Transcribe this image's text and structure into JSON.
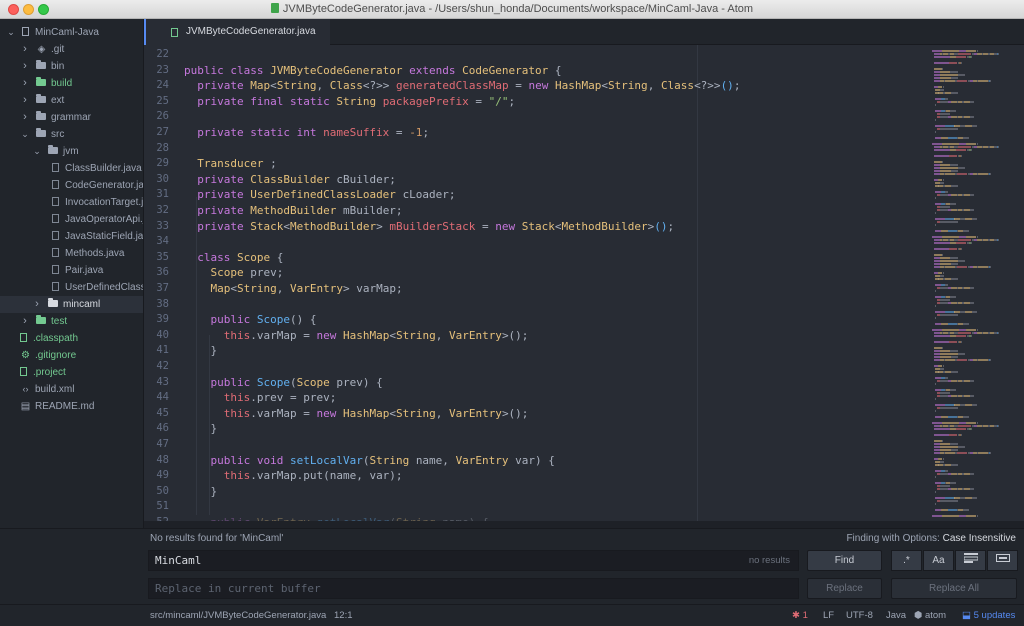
{
  "window": {
    "title": "JVMByteCodeGenerator.java - /Users/shun_honda/Documents/workspace/MinCaml-Java - Atom"
  },
  "tree": {
    "items": [
      {
        "label": "MinCaml-Java",
        "depth": 0,
        "type": "project",
        "expanded": true,
        "color": "normal"
      },
      {
        "label": ".git",
        "depth": 1,
        "type": "folder",
        "expanded": false,
        "color": "normal",
        "icon": "git-icon"
      },
      {
        "label": "bin",
        "depth": 1,
        "type": "folder",
        "expanded": false,
        "color": "normal"
      },
      {
        "label": "build",
        "depth": 1,
        "type": "folder",
        "expanded": false,
        "color": "green"
      },
      {
        "label": "ext",
        "depth": 1,
        "type": "folder",
        "expanded": false,
        "color": "normal"
      },
      {
        "label": "grammar",
        "depth": 1,
        "type": "folder",
        "expanded": false,
        "color": "normal"
      },
      {
        "label": "src",
        "depth": 1,
        "type": "folder",
        "expanded": true,
        "color": "normal"
      },
      {
        "label": "jvm",
        "depth": 2,
        "type": "folder",
        "expanded": true,
        "color": "normal"
      },
      {
        "label": "ClassBuilder.java",
        "depth": 3,
        "type": "file",
        "color": "normal"
      },
      {
        "label": "CodeGenerator.java",
        "depth": 3,
        "type": "file",
        "color": "normal"
      },
      {
        "label": "InvocationTarget.java",
        "depth": 3,
        "type": "file",
        "color": "normal"
      },
      {
        "label": "JavaOperatorApi.java",
        "depth": 3,
        "type": "file",
        "color": "normal"
      },
      {
        "label": "JavaStaticField.java",
        "depth": 3,
        "type": "file",
        "color": "normal"
      },
      {
        "label": "Methods.java",
        "depth": 3,
        "type": "file",
        "color": "normal"
      },
      {
        "label": "Pair.java",
        "depth": 3,
        "type": "file",
        "color": "normal"
      },
      {
        "label": "UserDefinedClassLoader.java",
        "depth": 3,
        "type": "file",
        "color": "normal"
      },
      {
        "label": "mincaml",
        "depth": 2,
        "type": "folder",
        "expanded": false,
        "color": "bright",
        "selected": true
      },
      {
        "label": "test",
        "depth": 1,
        "type": "folder",
        "expanded": false,
        "color": "green"
      },
      {
        "label": ".classpath",
        "depth": 1,
        "type": "file",
        "color": "green"
      },
      {
        "label": ".gitignore",
        "depth": 1,
        "type": "file",
        "color": "green",
        "icon": "gear-icon"
      },
      {
        "label": ".project",
        "depth": 1,
        "type": "file",
        "color": "green"
      },
      {
        "label": "build.xml",
        "depth": 1,
        "type": "file",
        "color": "normal",
        "icon": "code-icon"
      },
      {
        "label": "README.md",
        "depth": 1,
        "type": "file",
        "color": "normal",
        "icon": "markdown-icon"
      }
    ]
  },
  "tabs": [
    {
      "label": "JVMByteCodeGenerator.java",
      "active": true
    }
  ],
  "editor": {
    "lines": [
      {
        "num": "22",
        "tokens": []
      },
      {
        "num": "23",
        "tokens": [
          [
            "k",
            "public class "
          ],
          [
            "t",
            "JVMByteCodeGenerator "
          ],
          [
            "k",
            "extends "
          ],
          [
            "t",
            "CodeGenerator"
          ],
          [
            "p",
            " {"
          ]
        ]
      },
      {
        "num": "24",
        "tokens": [
          [
            "k",
            "  private "
          ],
          [
            "t",
            "Map"
          ],
          [
            "p",
            "<"
          ],
          [
            "t",
            "String"
          ],
          [
            "p",
            ", "
          ],
          [
            "t",
            "Class"
          ],
          [
            "p",
            "<?>> "
          ],
          [
            "v",
            "generatedClassMap"
          ],
          [
            "p",
            " = "
          ],
          [
            "k",
            "new "
          ],
          [
            "t",
            "HashMap"
          ],
          [
            "p",
            "<"
          ],
          [
            "t",
            "String"
          ],
          [
            "p",
            ", "
          ],
          [
            "t",
            "Class"
          ],
          [
            "p",
            "<?>>"
          ],
          [
            "f",
            "()"
          ],
          [
            "p",
            ";"
          ]
        ]
      },
      {
        "num": "25",
        "tokens": [
          [
            "k",
            "  private final static "
          ],
          [
            "t",
            "String "
          ],
          [
            "v",
            "packagePrefix"
          ],
          [
            "p",
            " = "
          ],
          [
            "s",
            "\"/\""
          ],
          [
            "p",
            ";"
          ]
        ]
      },
      {
        "num": "26",
        "tokens": []
      },
      {
        "num": "27",
        "tokens": [
          [
            "k",
            "  private static int "
          ],
          [
            "v",
            "nameSuffix"
          ],
          [
            "p",
            " = "
          ],
          [
            "n",
            "-1"
          ],
          [
            "p",
            ";"
          ]
        ]
      },
      {
        "num": "28",
        "tokens": []
      },
      {
        "num": "29",
        "tokens": [
          [
            "t",
            "  Transducer "
          ],
          [
            "p",
            ";"
          ]
        ]
      },
      {
        "num": "30",
        "tokens": [
          [
            "k",
            "  private "
          ],
          [
            "t",
            "ClassBuilder "
          ],
          [
            "p",
            "cBuilder;"
          ]
        ]
      },
      {
        "num": "31",
        "tokens": [
          [
            "k",
            "  private "
          ],
          [
            "t",
            "UserDefinedClassLoader "
          ],
          [
            "p",
            "cLoader;"
          ]
        ]
      },
      {
        "num": "32",
        "tokens": [
          [
            "k",
            "  private "
          ],
          [
            "t",
            "MethodBuilder "
          ],
          [
            "p",
            "mBuilder;"
          ]
        ]
      },
      {
        "num": "33",
        "tokens": [
          [
            "k",
            "  private "
          ],
          [
            "t",
            "Stack"
          ],
          [
            "p",
            "<"
          ],
          [
            "t",
            "MethodBuilder"
          ],
          [
            "p",
            "> "
          ],
          [
            "v",
            "mBuilderStack"
          ],
          [
            "p",
            " = "
          ],
          [
            "k",
            "new "
          ],
          [
            "t",
            "Stack"
          ],
          [
            "p",
            "<"
          ],
          [
            "t",
            "MethodBuilder"
          ],
          [
            "p",
            ">"
          ],
          [
            "f",
            "()"
          ],
          [
            "p",
            ";"
          ]
        ]
      },
      {
        "num": "34",
        "tokens": []
      },
      {
        "num": "35",
        "tokens": [
          [
            "k",
            "  class "
          ],
          [
            "t",
            "Scope"
          ],
          [
            "p",
            " {"
          ]
        ]
      },
      {
        "num": "36",
        "tokens": [
          [
            "t",
            "    Scope "
          ],
          [
            "p",
            "prev;"
          ]
        ]
      },
      {
        "num": "37",
        "tokens": [
          [
            "t",
            "    Map"
          ],
          [
            "p",
            "<"
          ],
          [
            "t",
            "String"
          ],
          [
            "p",
            ", "
          ],
          [
            "t",
            "VarEntry"
          ],
          [
            "p",
            "> varMap;"
          ]
        ]
      },
      {
        "num": "38",
        "tokens": []
      },
      {
        "num": "39",
        "tokens": [
          [
            "k",
            "    public "
          ],
          [
            "f",
            "Scope"
          ],
          [
            "p",
            "() {"
          ]
        ]
      },
      {
        "num": "40",
        "tokens": [
          [
            "v",
            "      this"
          ],
          [
            "p",
            ".varMap = "
          ],
          [
            "k",
            "new "
          ],
          [
            "t",
            "HashMap"
          ],
          [
            "p",
            "<"
          ],
          [
            "t",
            "String"
          ],
          [
            "p",
            ", "
          ],
          [
            "t",
            "VarEntry"
          ],
          [
            "p",
            ">();"
          ]
        ]
      },
      {
        "num": "41",
        "tokens": [
          [
            "p",
            "    }"
          ]
        ]
      },
      {
        "num": "42",
        "tokens": []
      },
      {
        "num": "43",
        "tokens": [
          [
            "k",
            "    public "
          ],
          [
            "f",
            "Scope"
          ],
          [
            "p",
            "("
          ],
          [
            "t",
            "Scope "
          ],
          [
            "p",
            "prev) {"
          ]
        ]
      },
      {
        "num": "44",
        "tokens": [
          [
            "v",
            "      this"
          ],
          [
            "p",
            ".prev = prev;"
          ]
        ]
      },
      {
        "num": "45",
        "tokens": [
          [
            "v",
            "      this"
          ],
          [
            "p",
            ".varMap = "
          ],
          [
            "k",
            "new "
          ],
          [
            "t",
            "HashMap"
          ],
          [
            "p",
            "<"
          ],
          [
            "t",
            "String"
          ],
          [
            "p",
            ", "
          ],
          [
            "t",
            "VarEntry"
          ],
          [
            "p",
            ">();"
          ]
        ]
      },
      {
        "num": "46",
        "tokens": [
          [
            "p",
            "    }"
          ]
        ]
      },
      {
        "num": "47",
        "tokens": []
      },
      {
        "num": "48",
        "tokens": [
          [
            "k",
            "    public void "
          ],
          [
            "f",
            "setLocalVar"
          ],
          [
            "p",
            "("
          ],
          [
            "t",
            "String "
          ],
          [
            "p",
            "name, "
          ],
          [
            "t",
            "VarEntry "
          ],
          [
            "p",
            "var) {"
          ]
        ]
      },
      {
        "num": "49",
        "tokens": [
          [
            "v",
            "      this"
          ],
          [
            "p",
            ".varMap.put(name, var);"
          ]
        ]
      },
      {
        "num": "50",
        "tokens": [
          [
            "p",
            "    }"
          ]
        ]
      },
      {
        "num": "51",
        "tokens": []
      },
      {
        "num": "52",
        "tokens": [
          [
            "k",
            "    public "
          ],
          [
            "t",
            "VarEntry "
          ],
          [
            "f",
            "getLocalVar"
          ],
          [
            "p",
            "("
          ],
          [
            "t",
            "String "
          ],
          [
            "p",
            "name) {"
          ]
        ]
      }
    ]
  },
  "find": {
    "message": "No results found for 'MinCaml'",
    "options_prefix": "Finding with Options: ",
    "options_value": "Case Insensitive",
    "query": "MinCaml",
    "result_count": "no results",
    "replace_placeholder": "Replace in current buffer",
    "find_label": "Find",
    "replace_label": "Replace",
    "replace_all_label": "Replace All",
    "opt_regex": ".*",
    "opt_case": "Aa"
  },
  "status": {
    "path": "src/mincaml/JVMByteCodeGenerator.java",
    "cursor": "12:1",
    "bug_count": "1",
    "line_ending": "LF",
    "encoding": "UTF-8",
    "grammar": "Java",
    "package": "atom",
    "updates": "5 updates"
  },
  "colors": {
    "keyword": "#c678dd",
    "type": "#e5c07b",
    "function": "#61afef",
    "string": "#98c379",
    "number": "#d19a66",
    "variable": "#e06c75",
    "vcs_added": "#73c990",
    "accent": "#568af2"
  }
}
